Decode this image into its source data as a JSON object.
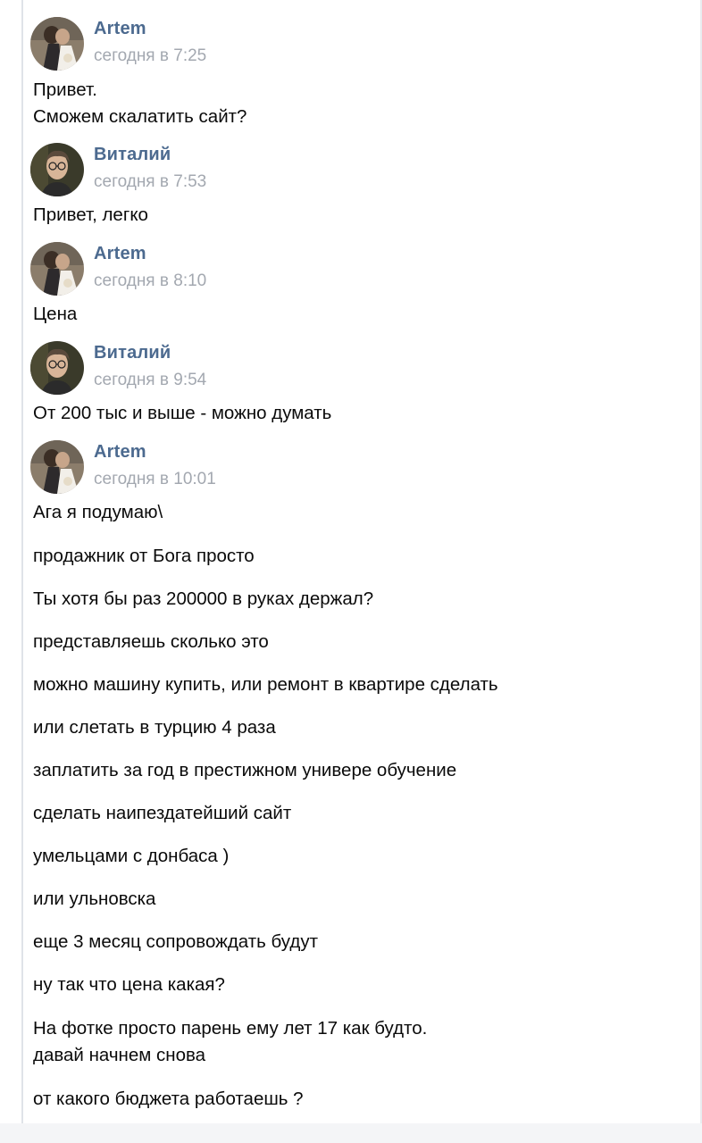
{
  "messages": [
    {
      "author": "Artem",
      "time": "сегодня в 7:25",
      "avatar": "wedding-photo-avatar",
      "lines": [
        "Привет.",
        "Сможем скалатить сайт?"
      ]
    },
    {
      "author": "Виталий",
      "time": "сегодня в 7:53",
      "avatar": "young-man-glasses-avatar",
      "lines": [
        "Привет, легко"
      ]
    },
    {
      "author": "Artem",
      "time": "сегодня в 8:10",
      "avatar": "wedding-photo-avatar",
      "lines": [
        "Цена"
      ]
    },
    {
      "author": "Виталий",
      "time": "сегодня в 9:54",
      "avatar": "young-man-glasses-avatar",
      "lines": [
        "От 200 тыс и выше - можно думать"
      ]
    },
    {
      "author": "Artem",
      "time": "сегодня в 10:01",
      "avatar": "wedding-photo-avatar",
      "lines": [
        "Ага я подумаю\\",
        "продажник от Бога просто",
        "Ты хотя бы раз 200000 в руках держал?",
        "представляешь сколько это",
        "можно машину купить, или ремонт в квартире сделать",
        "или слетать в турцию 4 раза",
        "заплатить за год в престижном универе обучение",
        "сделать наипездатейший сайт",
        "умельцами с донбаса )",
        "или ульновска",
        "еще 3 месяц сопровождать будут",
        "ну так что цена какая?",
        "На фотке просто парень ему лет 17 как будто.",
        "давай начнем снова",
        "от какого бюджета работаешь ?"
      ]
    }
  ],
  "colors": {
    "author": "#4c6a8f",
    "time": "#a3a8b0",
    "text": "#0a0a0a",
    "rule": "#dfe3e8"
  }
}
